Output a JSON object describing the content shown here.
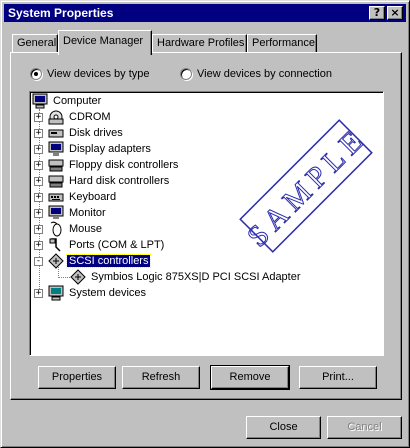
{
  "window": {
    "title": "System Properties",
    "help_label": "?",
    "close_label": "×"
  },
  "tabs": [
    {
      "label": "General",
      "active": false
    },
    {
      "label": "Device Manager",
      "active": true
    },
    {
      "label": "Hardware Profiles",
      "active": false
    },
    {
      "label": "Performance",
      "active": false
    }
  ],
  "view_options": [
    {
      "label": "View devices by type",
      "checked": true
    },
    {
      "label": "View devices by connection",
      "checked": false
    }
  ],
  "tree": {
    "root": {
      "label": "Computer",
      "icon": "computer-icon"
    },
    "items": [
      {
        "label": "CDROM",
        "icon": "cdrom-icon",
        "expander": "+"
      },
      {
        "label": "Disk drives",
        "icon": "disk-drive-icon",
        "expander": "+"
      },
      {
        "label": "Display adapters",
        "icon": "display-adapter-icon",
        "expander": "+"
      },
      {
        "label": "Floppy disk controllers",
        "icon": "floppy-controller-icon",
        "expander": "+"
      },
      {
        "label": "Hard disk controllers",
        "icon": "hard-disk-controller-icon",
        "expander": "+"
      },
      {
        "label": "Keyboard",
        "icon": "keyboard-icon",
        "expander": "+"
      },
      {
        "label": "Monitor",
        "icon": "monitor-icon",
        "expander": "+"
      },
      {
        "label": "Mouse",
        "icon": "mouse-icon",
        "expander": "+"
      },
      {
        "label": "Ports (COM & LPT)",
        "icon": "port-icon",
        "expander": "+"
      },
      {
        "label": "SCSI controllers",
        "icon": "scsi-controller-icon",
        "expander": "-",
        "selected": true
      },
      {
        "label": "System devices",
        "icon": "system-device-icon",
        "expander": "+"
      }
    ],
    "child": {
      "label": "Symbios Logic 875XS|D PCI SCSI Adapter",
      "icon": "scsi-controller-icon"
    }
  },
  "watermark": "SAMPLE",
  "device_buttons": {
    "properties": "Properties",
    "refresh": "Refresh",
    "remove": "Remove",
    "print": "Print..."
  },
  "dialog_buttons": {
    "close": "Close",
    "cancel": "Cancel"
  },
  "colors": {
    "titlebar": "#000080",
    "face": "#c0c0c0",
    "selection": "#000080",
    "watermark": "#2b2bb0"
  }
}
